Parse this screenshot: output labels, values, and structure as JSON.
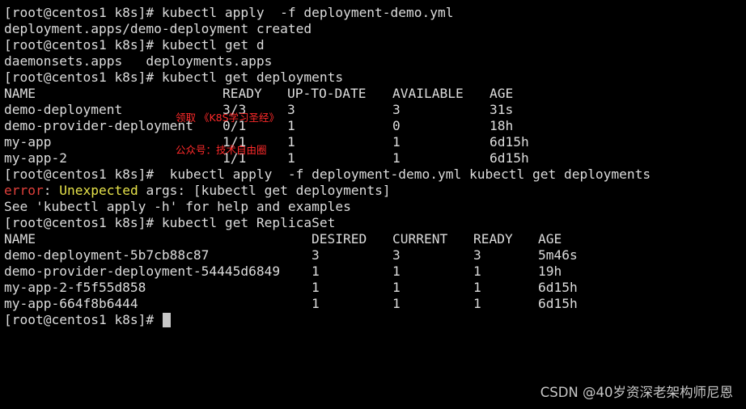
{
  "terminal": {
    "prompt": "[root@centos1 k8s]# ",
    "cmd1": "kubectl apply  -f deployment-demo.yml",
    "out1": "deployment.apps/demo-deployment created",
    "cmd2": "kubectl get d",
    "out2": "daemonsets.apps   deployments.apps",
    "cmd3": "kubectl get deployments",
    "deploy_table": {
      "headers": [
        "NAME",
        "READY",
        "UP-TO-DATE",
        "AVAILABLE",
        "AGE"
      ],
      "rows": [
        [
          "demo-deployment",
          "3/3",
          "3",
          "3",
          "31s"
        ],
        [
          "demo-provider-deployment",
          "0/1",
          "1",
          "0",
          "18h"
        ],
        [
          "my-app",
          "1/1",
          "1",
          "1",
          "6d15h"
        ],
        [
          "my-app-2",
          "1/1",
          "1",
          "1",
          "6d15h"
        ]
      ]
    },
    "cmd4": " kubectl apply  -f deployment-demo.yml kubectl get deployments",
    "error_label": "error",
    "error_colon": ": ",
    "error_word": "Unexpected",
    "error_rest": " args: [kubectl get deployments]",
    "hint": "See 'kubectl apply -h' for help and examples",
    "cmd5": "kubectl get ReplicaSet",
    "rs_table": {
      "headers": [
        "NAME",
        "DESIRED",
        "CURRENT",
        "READY",
        "AGE"
      ],
      "rows": [
        [
          "demo-deployment-5b7cb88c87",
          "3",
          "3",
          "3",
          "5m46s"
        ],
        [
          "demo-provider-deployment-54445d6849",
          "1",
          "1",
          "1",
          "19h"
        ],
        [
          "my-app-2-f5f55d858",
          "1",
          "1",
          "1",
          "6d15h"
        ],
        [
          "my-app-664f8b6444",
          "1",
          "1",
          "1",
          "6d15h"
        ]
      ]
    }
  },
  "overlay": {
    "line1": "领取 《K8S学习圣经》",
    "line2": "公众号：技术自由圈"
  },
  "watermark": "CSDN @40岁资深老架构师尼恩",
  "colors": {
    "background": "#000000",
    "text": "#dcdcdc",
    "error": "#e0403b",
    "warning": "#e6e24a",
    "overlay": "#ff2a2a"
  }
}
